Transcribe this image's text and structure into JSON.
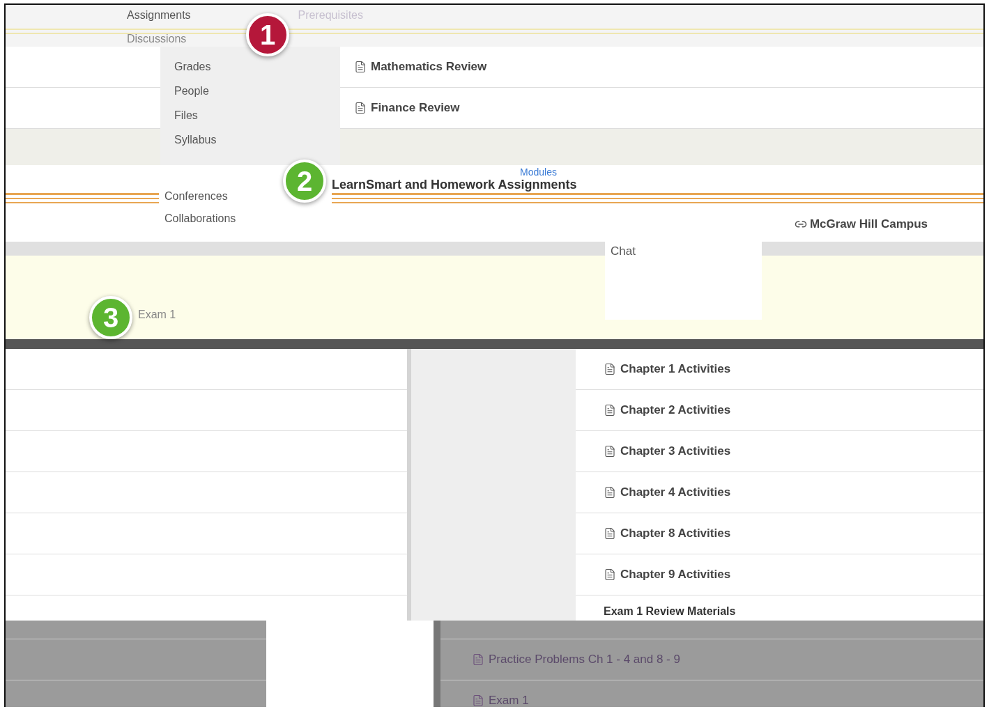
{
  "nav": {
    "items": [
      {
        "label": "Assignments"
      },
      {
        "label": "Discussions"
      }
    ],
    "prerequisites": "Prerequisites"
  },
  "badges": [
    {
      "label": "1",
      "color": "#b5173a"
    },
    {
      "label": "2",
      "color": "#5cb531"
    },
    {
      "label": "3",
      "color": "#5cb531"
    }
  ],
  "menu": [
    "Grades",
    "People",
    "Files",
    "Syllabus"
  ],
  "top_items": [
    {
      "title": "Mathematics Review"
    },
    {
      "title": "Finance Review"
    }
  ],
  "modules_link": "Modules",
  "section_title": "LearnSmart and Homework Assignments",
  "menu2": [
    "Conferences",
    "Collaborations"
  ],
  "external_link": "McGraw Hill Campus",
  "chat": "Chat",
  "exam_header": "Exam 1",
  "chapters": [
    "Chapter 1 Activities",
    "Chapter 2 Activities",
    "Chapter 3 Activities",
    "Chapter 4 Activities",
    "Chapter 8 Activities",
    "Chapter 9 Activities"
  ],
  "review_header": "Exam 1 Review Materials",
  "review_items": [
    "Practice Problems Ch 1 - 4 and 8 - 9",
    "Exam 1"
  ]
}
